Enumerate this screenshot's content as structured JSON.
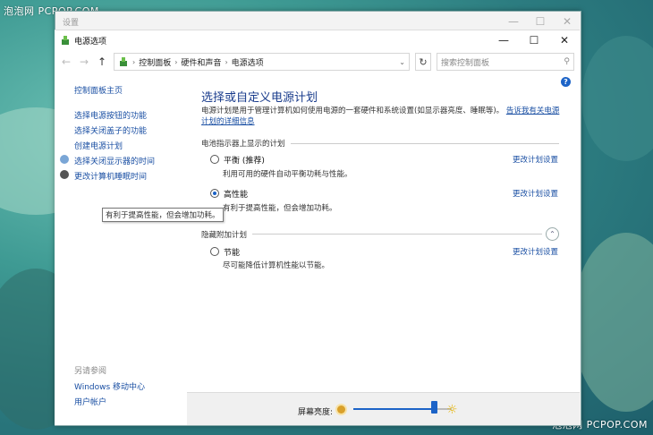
{
  "watermark": {
    "top_left": "泡泡网 PCPOP.COM",
    "bottom_right": "泡泡网 PCPOP.COM"
  },
  "outer_window": {
    "title": "设置",
    "controls": [
      "—",
      "☐",
      "✕"
    ]
  },
  "window": {
    "title": "电源选项",
    "controls": {
      "minimize": "—",
      "maximize": "☐",
      "close": "✕"
    }
  },
  "address_bar": {
    "back": "←",
    "forward": "→",
    "up": "↑",
    "breadcrumb": [
      "控制面板",
      "硬件和声音",
      "电源选项"
    ],
    "refresh": "↻",
    "search_placeholder": "搜索控制面板",
    "search_icon": "⚲"
  },
  "sidebar": {
    "home": "控制面板主页",
    "links": [
      "选择电源按钮的功能",
      "选择关闭盖子的功能",
      "创建电源计划",
      "选择关闭显示器的时间",
      "更改计算机睡眠时间"
    ],
    "see_also": "另请参阅",
    "see_also_links": [
      "Windows 移动中心",
      "用户帐户"
    ]
  },
  "main": {
    "help": "?",
    "title": "选择或自定义电源计划",
    "desc_text": "电源计划是用于管理计算机如何使用电源的一套硬件和系统设置(如显示器亮度、睡眠等)。",
    "desc_link": "告诉我有关电源计划的详细信息",
    "section_battery": "电池指示器上显示的计划",
    "section_hidden": "隐藏附加计划",
    "change_link": "更改计划设置",
    "plans": [
      {
        "name": "平衡 (推荐)",
        "desc": "利用可用的硬件自动平衡功耗与性能。",
        "selected": false
      },
      {
        "name": "高性能",
        "desc": "有利于提高性能，但会增加功耗。",
        "selected": true
      },
      {
        "name": "节能",
        "desc": "尽可能降低计算机性能以节能。",
        "selected": false
      }
    ],
    "tooltip": "有利于提高性能，但会增加功耗。"
  },
  "brightness": {
    "label": "屏幕亮度:",
    "level": 0.82
  },
  "colors": {
    "accent": "#1c63c7",
    "link": "#1a4fa3",
    "title": "#1a3c8c"
  }
}
